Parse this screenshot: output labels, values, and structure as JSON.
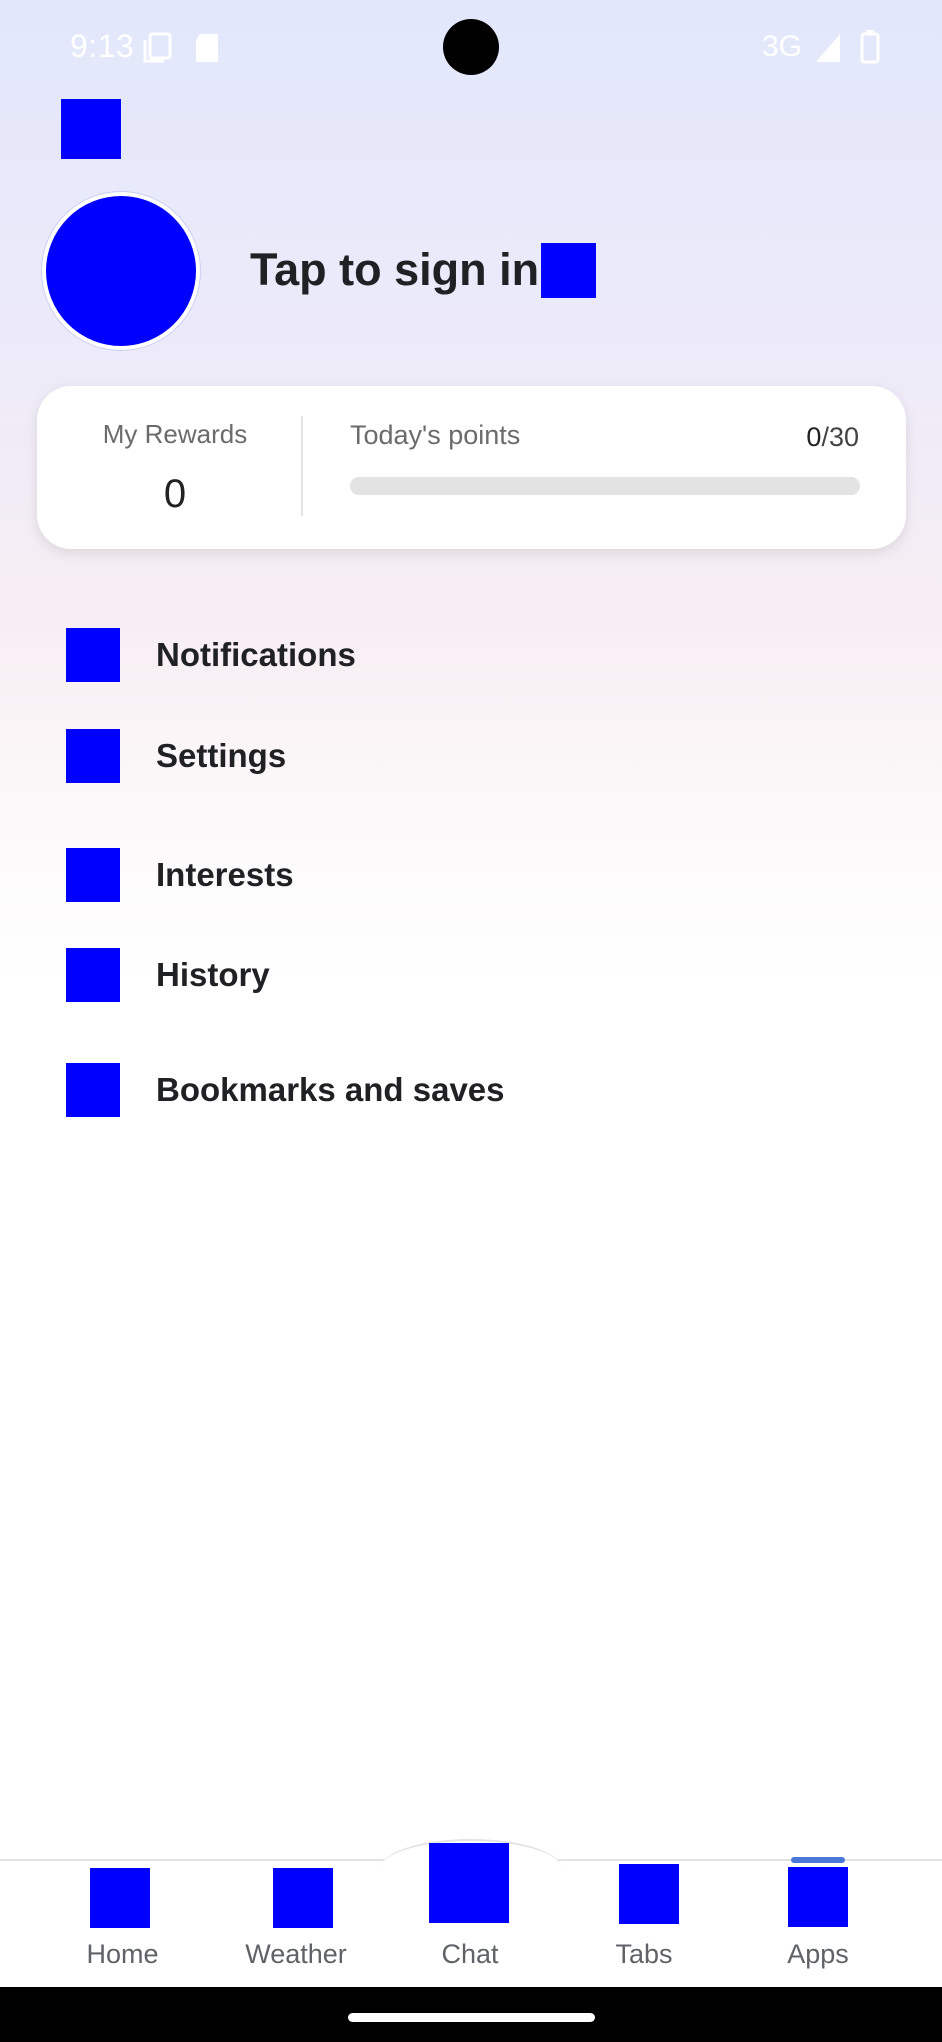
{
  "status_bar": {
    "time": "9:13",
    "network": "3G",
    "icons": [
      "screen-copy-icon",
      "sd-card-icon",
      "signal-icon",
      "battery-icon"
    ]
  },
  "header": {
    "corner_icon": "menu-icon"
  },
  "profile": {
    "sign_in_text": "Tap to sign in",
    "avatar_icon": "avatar-icon",
    "trailing_icon": "chevron-icon"
  },
  "rewards": {
    "label": "My Rewards",
    "value": "0",
    "points_label": "Today's points",
    "points_current": "0",
    "points_separator": "/",
    "points_total": "30",
    "progress_fraction": 0
  },
  "menu": {
    "items": [
      {
        "label": "Notifications",
        "icon": "bell-icon"
      },
      {
        "label": "Settings",
        "icon": "gear-icon"
      },
      {
        "label": "Interests",
        "icon": "interests-icon"
      },
      {
        "label": "History",
        "icon": "history-icon"
      },
      {
        "label": "Bookmarks and saves",
        "icon": "bookmark-icon"
      }
    ]
  },
  "bottom_nav": {
    "items": [
      {
        "label": "Home",
        "icon": "home-icon"
      },
      {
        "label": "Weather",
        "icon": "weather-icon"
      },
      {
        "label": "Chat",
        "icon": "chat-icon"
      },
      {
        "label": "Tabs",
        "icon": "tabs-icon"
      },
      {
        "label": "Apps",
        "icon": "apps-icon"
      }
    ],
    "active": "Apps"
  },
  "colors": {
    "placeholder_icon": "#0000ff",
    "accent": "#4a78d6",
    "text_primary": "#202124",
    "text_secondary": "#6b6b6b"
  }
}
